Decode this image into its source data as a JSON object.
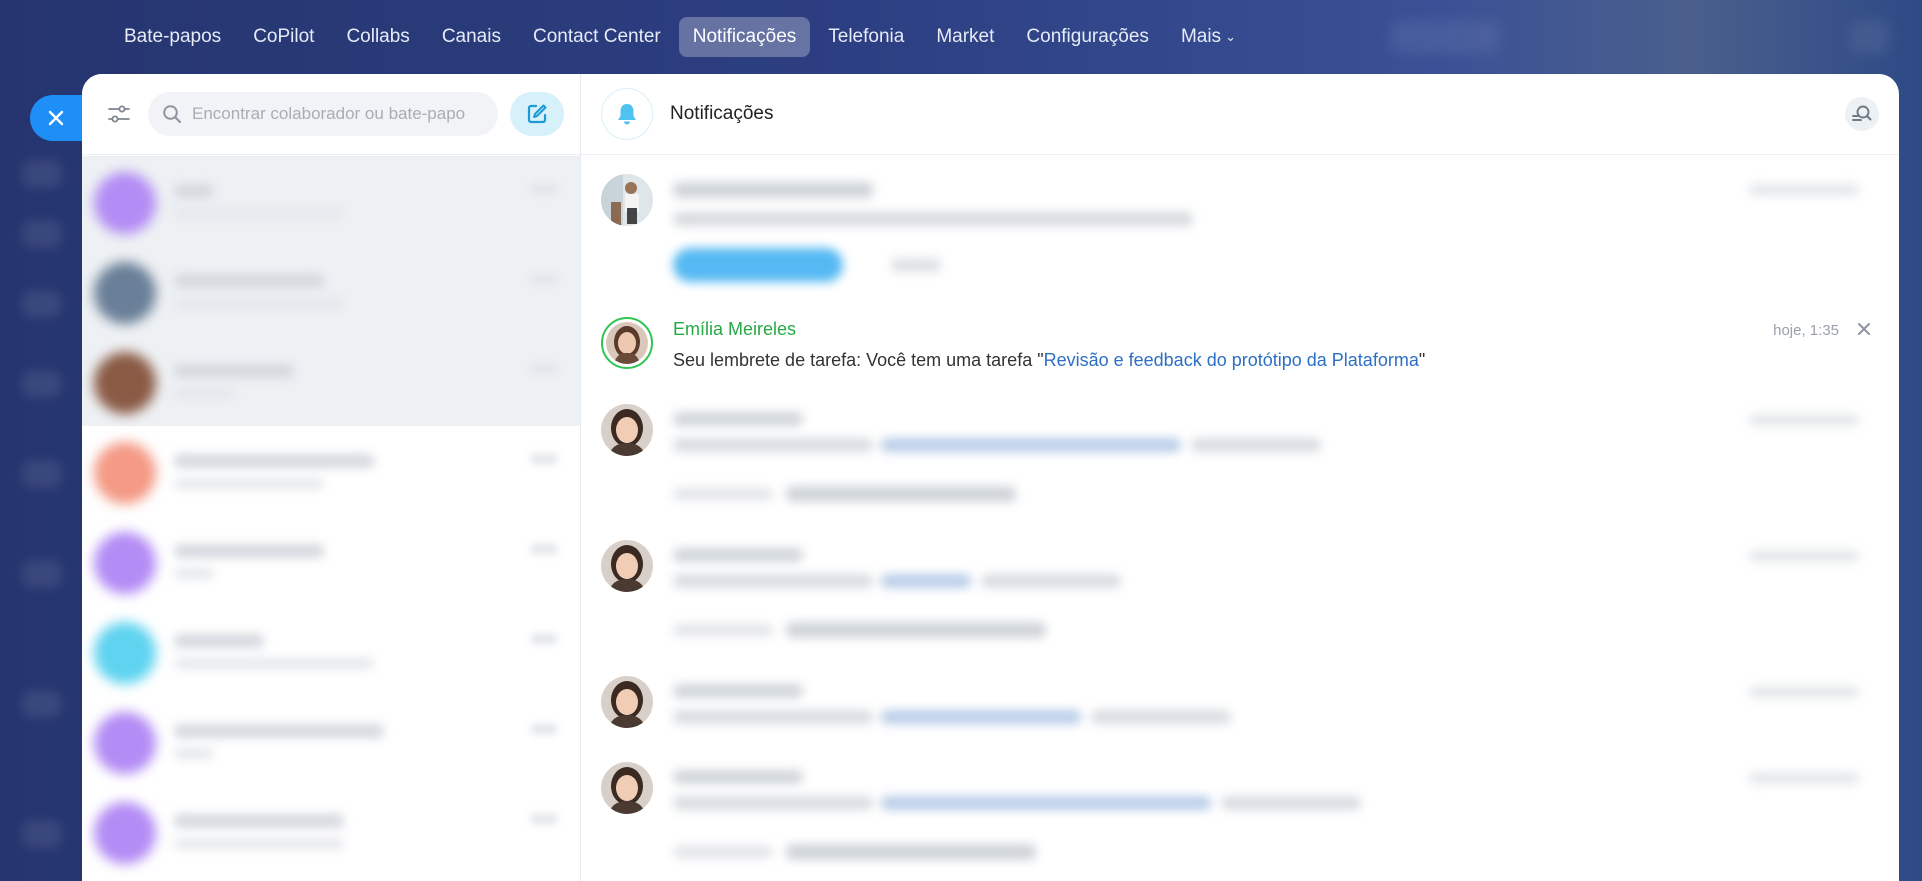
{
  "nav": {
    "items": [
      {
        "label": "Bate-papos",
        "active": false
      },
      {
        "label": "CoPilot",
        "active": false
      },
      {
        "label": "Collabs",
        "active": false
      },
      {
        "label": "Canais",
        "active": false
      },
      {
        "label": "Contact Center",
        "active": false
      },
      {
        "label": "Notificações",
        "active": true
      },
      {
        "label": "Telefonia",
        "active": false
      },
      {
        "label": "Market",
        "active": false
      },
      {
        "label": "Configurações",
        "active": false
      }
    ],
    "more_label": "Mais"
  },
  "sidebar": {
    "search_placeholder": "Encontrar colaborador ou bate-papo"
  },
  "panel": {
    "title": "Notificações"
  },
  "focused_notification": {
    "author": "Emília Meireles",
    "time": "hoje, 1:35",
    "message_prefix": "Seu lembrete de tarefa: Você tem uma tarefa \"",
    "task_link": "Revisão e feedback do protótipo da Plataforma",
    "message_suffix": "\""
  },
  "colors": {
    "accent": "#1e8ff7",
    "author_green": "#27a844",
    "link_blue": "#2d6fc4",
    "active_nav_bg": "rgba(255,255,255,0.28)"
  }
}
